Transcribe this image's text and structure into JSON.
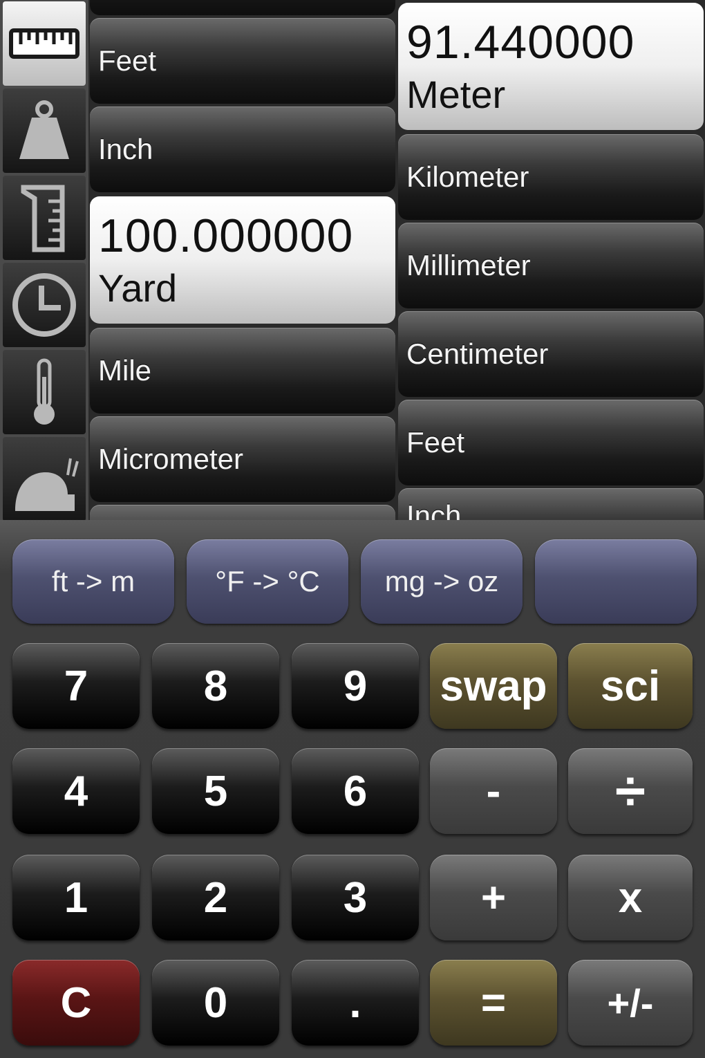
{
  "tabs": [
    {
      "icon": "ruler-icon",
      "active": true
    },
    {
      "icon": "weight-icon",
      "active": false
    },
    {
      "icon": "measuring-cup-icon",
      "active": false
    },
    {
      "icon": "clock-icon",
      "active": false
    },
    {
      "icon": "thermometer-icon",
      "active": false
    },
    {
      "icon": "snail-icon",
      "active": false
    }
  ],
  "from_units": {
    "items": [
      "Feet",
      "Inch",
      "Yard",
      "Mile",
      "Micrometer"
    ],
    "selected": {
      "value": "100.000000",
      "unit": "Yard"
    }
  },
  "to_units": {
    "items": [
      "Meter",
      "Kilometer",
      "Millimeter",
      "Centimeter",
      "Feet",
      "Inch"
    ],
    "selected": {
      "value": "91.440000",
      "unit": "Meter"
    }
  },
  "quick": {
    "q1": "ft -> m",
    "q2": "°F -> °C",
    "q3": "mg -> oz",
    "q4": ""
  },
  "keys": {
    "k7": "7",
    "k8": "8",
    "k9": "9",
    "swap": "swap",
    "sci": "sci",
    "k4": "4",
    "k5": "5",
    "k6": "6",
    "minus": "-",
    "divide": "÷",
    "k1": "1",
    "k2": "2",
    "k3": "3",
    "plus": "+",
    "multiply": "x",
    "clear": "C",
    "k0": "0",
    "dot": ".",
    "equals": "=",
    "sign": "+/-"
  },
  "colors": {
    "quick_button": "#4e5170",
    "gold_button": "#5c5230",
    "clear_button": "#5a1515",
    "selected_row": "#efefef"
  }
}
